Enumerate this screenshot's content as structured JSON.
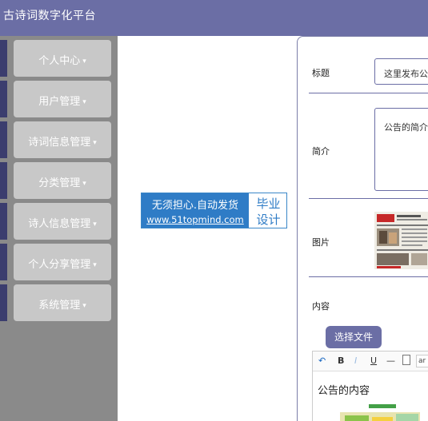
{
  "app": {
    "title": "古诗词数字化平台"
  },
  "sidebar": {
    "items": [
      {
        "label": "个人中心"
      },
      {
        "label": "用户管理"
      },
      {
        "label": "诗词信息管理"
      },
      {
        "label": "分类管理"
      },
      {
        "label": "诗人信息管理"
      },
      {
        "label": "个人分享管理"
      },
      {
        "label": "系统管理"
      }
    ],
    "caret": "▾"
  },
  "watermark": {
    "line1": "无须担心.自动发货",
    "line2": "www.51topmind.com",
    "right1": "毕业",
    "right2": "设计"
  },
  "form": {
    "title_label": "标题",
    "title_value": "这里发布公",
    "summary_label": "简介",
    "summary_value": "公告的简介",
    "image_label": "图片",
    "content_label": "内容",
    "file_button": "选择文件",
    "toolbar": {
      "undo": "↶",
      "bold": "B",
      "italic": "I",
      "underline": "U",
      "hr": "—",
      "font_value": "ar"
    },
    "content_text": "公告的内容"
  },
  "colors": {
    "topbar": "#6b6ea5",
    "sidebar": "#8a8a8a",
    "accent": "#6b6ea5"
  }
}
